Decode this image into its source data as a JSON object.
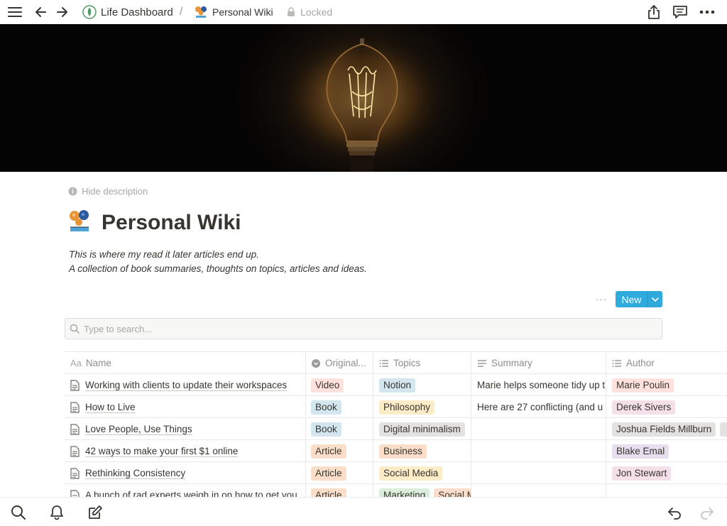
{
  "topbar": {
    "breadcrumb_parent": "Life Dashboard",
    "separator": "/",
    "breadcrumb_current": "Personal Wiki",
    "locked_label": "Locked"
  },
  "page": {
    "hide_description_label": "Hide description",
    "title": "Personal Wiki",
    "description_line1": "This is where my read it later articles end up.",
    "description_line2": "A collection of book summaries, thoughts on topics, articles and ideas."
  },
  "toolbar": {
    "more_label": "···",
    "new_label": "New"
  },
  "search": {
    "placeholder": "Type to search..."
  },
  "table": {
    "columns": [
      "Name",
      "Original...",
      "Topics",
      "Summary",
      "Author"
    ],
    "rows": [
      {
        "name": "Working with clients to update their workspaces",
        "original": "Video",
        "original_color": "#ffe2dd",
        "topics": [
          {
            "label": "Notion",
            "color": "#d3e5ef"
          }
        ],
        "summary": "Marie helps someone tidy up t",
        "author": [
          {
            "label": "Marie Poulin",
            "color": "#ffe2dd"
          }
        ]
      },
      {
        "name": "How to Live",
        "original": "Book",
        "original_color": "#d3e5ef",
        "topics": [
          {
            "label": "Philosophy",
            "color": "#fdecc8"
          }
        ],
        "summary": "Here are 27 conflicting (and u",
        "author": [
          {
            "label": "Derek Sivers",
            "color": "#f5e0e9"
          }
        ]
      },
      {
        "name": "Love People, Use Things",
        "original": "Book",
        "original_color": "#d3e5ef",
        "topics": [
          {
            "label": "Digital minimalism",
            "color": "#e3e2e0"
          }
        ],
        "summary": "",
        "author": [
          {
            "label": "Joshua Fields Millburn",
            "color": "#e3e2e0"
          },
          {
            "label": "",
            "color": "#e3e2e0"
          }
        ]
      },
      {
        "name": "42 ways to make your first $1 online",
        "original": "Article",
        "original_color": "#fadec9",
        "topics": [
          {
            "label": "Business",
            "color": "#fadec9"
          }
        ],
        "summary": "",
        "author": [
          {
            "label": "Blake Emal",
            "color": "#e8deee"
          }
        ]
      },
      {
        "name": "Rethinking Consistency",
        "original": "Article",
        "original_color": "#fadec9",
        "topics": [
          {
            "label": "Social Media",
            "color": "#fdecc8"
          }
        ],
        "summary": "",
        "author": [
          {
            "label": "Jon Stewart",
            "color": "#f5e0e9"
          }
        ]
      },
      {
        "name": "A bunch of rad experts weigh in on how to get you",
        "original": "Article",
        "original_color": "#fadec9",
        "topics": [
          {
            "label": "Marketing",
            "color": "#dbeddb"
          },
          {
            "label": "Social M",
            "color": "#fadec9"
          }
        ],
        "summary": "",
        "author": []
      }
    ]
  },
  "icons": {
    "menu": "hamburger-icon",
    "back": "arrow-left-icon",
    "forward": "arrow-right-icon",
    "workspace": "leaf-icon",
    "page": "wiki-emoji-icon",
    "lock": "lock-icon",
    "share": "share-icon",
    "comments": "comment-icon",
    "more": "more-icon",
    "search": "search-icon",
    "notifications": "bell-icon",
    "new_page": "compose-icon",
    "undo": "undo-icon",
    "redo": "redo-icon"
  },
  "colors": {
    "accent": "#2eaadc",
    "text": "#37352f",
    "muted": "#9b9a97"
  }
}
